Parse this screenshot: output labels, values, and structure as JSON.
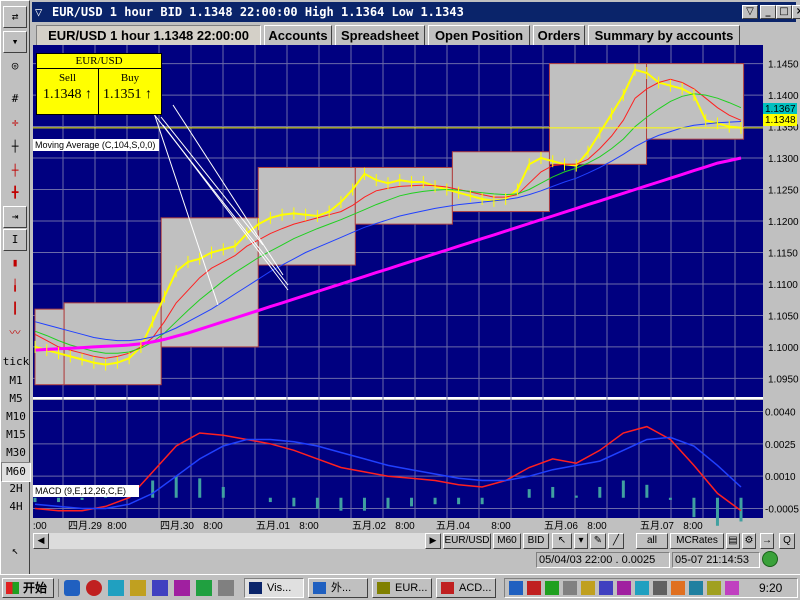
{
  "window": {
    "title": "EUR/USD 1 hour BID 1.1348 22:00:00 High 1.1364 Low 1.1343",
    "buttons": [
      "_",
      "□",
      "×"
    ]
  },
  "tabs": [
    {
      "label": "EUR/USD 1 hour 1.1348 22:00:00",
      "active": true
    },
    {
      "label": "Accounts",
      "active": false
    },
    {
      "label": "Spreadsheet",
      "active": false
    },
    {
      "label": "Open Position",
      "active": false
    },
    {
      "label": "Orders",
      "active": false
    },
    {
      "label": "Summary by accounts",
      "active": false
    }
  ],
  "toolbar": {
    "timeframes": [
      "tick",
      "M1",
      "M5",
      "M10",
      "M15",
      "M30",
      "M60",
      "2H",
      "4H"
    ],
    "active_timeframe": "M60"
  },
  "quote": {
    "symbol": "EUR/USD",
    "sell_label": "Sell",
    "buy_label": "Buy",
    "sell_price": "1.1348",
    "buy_price": "1.1351",
    "sell_arrow": "↑",
    "buy_arrow": "↑"
  },
  "indicators": {
    "moving_average": "Moving Average (C,104,S,0,0)",
    "macd": "MACD (9,E,12,26,C,E)"
  },
  "colors": {
    "chart_bg": "#000080",
    "price_line": "#ffff00",
    "ma_slow": "#ff00ff",
    "box_fill": "#c0c0c0",
    "accent": "#0a246a"
  },
  "chart_data": [
    {
      "type": "line",
      "title": "EUR/USD 1 hour BID",
      "ylim": [
        1.093,
        1.147
      ],
      "yticks": [
        1.095,
        1.1,
        1.105,
        1.11,
        1.115,
        1.12,
        1.125,
        1.13,
        1.135,
        1.14,
        1.145
      ],
      "ytick_labels": [
        "1.0950",
        "1.1000",
        "1.1050",
        "1.1100",
        "1.1150",
        "1.1200",
        "1.1250",
        "1.1300",
        "1.1350",
        "1.1400",
        "1.1450"
      ],
      "current_buy_label": "1.1367",
      "current_price_label": "1.1348",
      "x": [
        0,
        1,
        2,
        3,
        4,
        5,
        6,
        7,
        8,
        9,
        10,
        11,
        12,
        13,
        14,
        15,
        16,
        17,
        18,
        19,
        20,
        21,
        22,
        23,
        24,
        25,
        26,
        27,
        28,
        29,
        30,
        31,
        32,
        33,
        34,
        35,
        36,
        37,
        38,
        39,
        40,
        41,
        42,
        43,
        44,
        45,
        46,
        47,
        48,
        49,
        50,
        51,
        52,
        53,
        54,
        55,
        56,
        57,
        58,
        59,
        60
      ],
      "series": [
        {
          "role": "price",
          "values": [
            1.1,
            1.0995,
            1.099,
            1.0985,
            1.098,
            1.0975,
            1.0972,
            1.0975,
            1.0982,
            1.1,
            1.104,
            1.108,
            1.112,
            1.1135,
            1.114,
            1.115,
            1.1155,
            1.116,
            1.118,
            1.1195,
            1.1205,
            1.121,
            1.1212,
            1.121,
            1.1208,
            1.1215,
            1.123,
            1.125,
            1.1275,
            1.1265,
            1.126,
            1.1265,
            1.1262,
            1.1262,
            1.1255,
            1.125,
            1.1245,
            1.124,
            1.1235,
            1.1232,
            1.1235,
            1.125,
            1.129,
            1.13,
            1.1295,
            1.129,
            1.1288,
            1.131,
            1.134,
            1.137,
            1.14,
            1.144,
            1.1435,
            1.142,
            1.1415,
            1.141,
            1.14,
            1.136,
            1.1355,
            1.135,
            1.1348
          ]
        },
        {
          "role": "ma-fast",
          "values": [
            1.102,
            1.101,
            1.1,
            1.0995,
            1.099,
            1.0985,
            1.0982,
            1.0985,
            1.099,
            1.1,
            1.1015,
            1.104,
            1.107,
            1.109,
            1.111,
            1.1125,
            1.1135,
            1.1145,
            1.116,
            1.117,
            1.118,
            1.1188,
            1.1195,
            1.12,
            1.1205,
            1.121,
            1.1215,
            1.1225,
            1.1238,
            1.1248,
            1.1252,
            1.1255,
            1.1256,
            1.1257,
            1.1256,
            1.1254,
            1.125,
            1.1246,
            1.1242,
            1.1238,
            1.1238,
            1.1242,
            1.126,
            1.1278,
            1.1288,
            1.129,
            1.129,
            1.1298,
            1.1315,
            1.1335,
            1.136,
            1.1395,
            1.141,
            1.142,
            1.1425,
            1.142,
            1.141,
            1.1395,
            1.138,
            1.1368,
            1.136
          ]
        },
        {
          "role": "ma-mid",
          "values": [
            1.1025,
            1.1018,
            1.101,
            1.1003,
            1.0998,
            1.0993,
            1.099,
            1.099,
            1.0992,
            1.0998,
            1.1008,
            1.1022,
            1.104,
            1.1058,
            1.1075,
            1.109,
            1.1105,
            1.1118,
            1.113,
            1.1142,
            1.1152,
            1.1162,
            1.1172,
            1.118,
            1.1188,
            1.1195,
            1.1202,
            1.121,
            1.1218,
            1.1226,
            1.1233,
            1.124,
            1.1244,
            1.1247,
            1.1249,
            1.125,
            1.1249,
            1.1247,
            1.1245,
            1.1243,
            1.1242,
            1.1243,
            1.125,
            1.126,
            1.127,
            1.1278,
            1.1284,
            1.1292,
            1.1302,
            1.1315,
            1.133,
            1.135,
            1.1365,
            1.1378,
            1.139,
            1.1398,
            1.1402,
            1.14,
            1.1395,
            1.1388,
            1.138
          ]
        },
        {
          "role": "ma-blue",
          "values": [
            1.104,
            1.1035,
            1.103,
            1.1025,
            1.102,
            1.1015,
            1.1012,
            1.101,
            1.101,
            1.1012,
            1.1016,
            1.1022,
            1.103,
            1.104,
            1.105,
            1.106,
            1.1072,
            1.1084,
            1.1096,
            1.1108,
            1.112,
            1.113,
            1.114,
            1.115,
            1.1158,
            1.1166,
            1.1174,
            1.1182,
            1.119,
            1.1196,
            1.1202,
            1.1208,
            1.1212,
            1.1216,
            1.122,
            1.1223,
            1.1226,
            1.1228,
            1.123,
            1.1232,
            1.1234,
            1.1237,
            1.1242,
            1.1248,
            1.1255,
            1.1262,
            1.1268,
            1.1276,
            1.1285,
            1.1295,
            1.1306,
            1.1318,
            1.1328,
            1.1336,
            1.1342,
            1.1348,
            1.1352,
            1.1354,
            1.1356,
            1.1357,
            1.1358
          ]
        },
        {
          "role": "ma-slow",
          "values": [
            1.0995,
            1.0996,
            1.0997,
            1.0998,
            1.0999,
            1.1,
            1.1001,
            1.1002,
            1.1003,
            1.1005,
            1.1008,
            1.1012,
            1.1017,
            1.1022,
            1.1028,
            1.1034,
            1.104,
            1.1046,
            1.1052,
            1.1058,
            1.1064,
            1.107,
            1.1076,
            1.1082,
            1.1088,
            1.1094,
            1.11,
            1.1106,
            1.1112,
            1.1118,
            1.1124,
            1.113,
            1.1136,
            1.1142,
            1.1148,
            1.1154,
            1.116,
            1.1166,
            1.1172,
            1.1178,
            1.1184,
            1.119,
            1.1196,
            1.1202,
            1.1208,
            1.1214,
            1.122,
            1.1226,
            1.1232,
            1.1238,
            1.1244,
            1.125,
            1.1256,
            1.1262,
            1.1268,
            1.1274,
            1.128,
            1.1286,
            1.1292,
            1.1296,
            1.13
          ]
        }
      ],
      "channels": [
        {
          "x0": 0,
          "x1": 3,
          "top": 1.106,
          "bottom": 1.094
        },
        {
          "x0": 3,
          "x1": 13,
          "top": 1.107,
          "bottom": 1.094
        },
        {
          "x0": 13,
          "x1": 23,
          "top": 1.1205,
          "bottom": 1.1
        },
        {
          "x0": 23,
          "x1": 32,
          "top": 1.1285,
          "bottom": 1.113
        },
        {
          "x0": 32,
          "x1": 41,
          "top": 1.1285,
          "bottom": 1.1195
        },
        {
          "x0": 41,
          "x1": 51,
          "top": 1.131,
          "bottom": 1.1215
        },
        {
          "x0": 51,
          "x1": 61,
          "top": 1.145,
          "bottom": 1.129
        },
        {
          "x0": 61,
          "x1": 71,
          "top": 1.145,
          "bottom": 1.133
        }
      ]
    },
    {
      "type": "line",
      "title": "MACD (9,E,12,26,C,E)",
      "ylim": [
        -0.0008,
        0.0043
      ],
      "yticks": [
        0.004,
        0.0025,
        0.001,
        -0.0005
      ],
      "ytick_labels": [
        "0.0040",
        "0.0025",
        "0.0010",
        "-0.0005"
      ],
      "xtick_labels": [
        "0:00",
        "四月.29",
        "8:00",
        "四月.30",
        "8:00",
        "五月.01",
        "8:00",
        "五月.02",
        "8:00",
        "五月.04",
        "8:00",
        "五月.06",
        "8:00",
        "五月.07",
        "8:00"
      ],
      "x": [
        0,
        1,
        2,
        3,
        4,
        5,
        6,
        7,
        8,
        9,
        10,
        11,
        12,
        13,
        14,
        15,
        16,
        17,
        18,
        19,
        20,
        21,
        22,
        23,
        24,
        25,
        26,
        27,
        28,
        29,
        30
      ],
      "series": [
        {
          "role": "macd",
          "values": [
            -0.0005,
            -0.0006,
            -0.0006,
            -0.0004,
            0.0,
            0.0012,
            0.0024,
            0.003,
            0.0029,
            0.0027,
            0.0025,
            0.0022,
            0.0018,
            0.0014,
            0.0012,
            0.001,
            0.0009,
            0.0008,
            0.0006,
            0.0005,
            0.0008,
            0.0014,
            0.0018,
            0.0016,
            0.0022,
            0.003,
            0.0033,
            0.0027,
            0.0015,
            0.0002,
            -0.0006
          ]
        },
        {
          "role": "signal",
          "values": [
            -0.0003,
            -0.0004,
            -0.0005,
            -0.0005,
            -0.0003,
            0.0002,
            0.001,
            0.0018,
            0.0024,
            0.0027,
            0.0027,
            0.0026,
            0.0024,
            0.0021,
            0.0018,
            0.0015,
            0.0013,
            0.0011,
            0.0009,
            0.0008,
            0.0008,
            0.001,
            0.0013,
            0.0015,
            0.0017,
            0.0022,
            0.0027,
            0.0028,
            0.0024,
            0.0015,
            0.0005
          ]
        }
      ],
      "histogram": [
        -0.0002,
        -0.0002,
        -0.0001,
        0.0001,
        0.0003,
        0.0008,
        0.001,
        0.0009,
        0.0005,
        0.0,
        -0.0002,
        -0.0004,
        -0.0005,
        -0.0006,
        -0.0006,
        -0.0005,
        -0.0004,
        -0.0003,
        -0.0003,
        -0.0003,
        0.0,
        0.0004,
        0.0005,
        0.0001,
        0.0005,
        0.0008,
        0.0006,
        -0.0001,
        -0.0009,
        -0.0013,
        -0.0011
      ]
    }
  ],
  "statusbar": {
    "buttons": [
      "EUR/USD",
      "M60",
      "BID",
      "all",
      "MCRates"
    ],
    "cursor_info": "05/04/03 22:00 . 0.0025",
    "time": "05-07 21:14:53"
  },
  "taskbar": {
    "start_label": "开始",
    "tasks": [
      "Vis...",
      "外...",
      "EUR...",
      "ACD..."
    ],
    "clock": "9:20"
  }
}
